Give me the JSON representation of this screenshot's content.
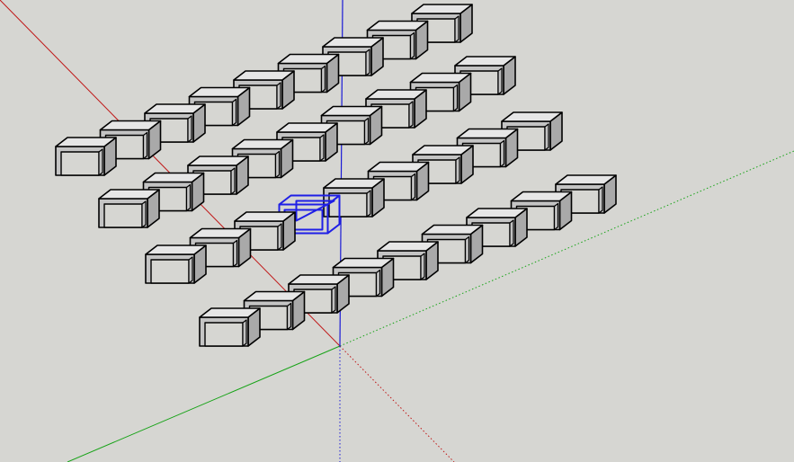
{
  "viewport": {
    "background": "#d6d6d2",
    "axes": {
      "red": "#c01818",
      "green": "#17a317",
      "blue": "#1a1ad6"
    },
    "selection_color": "#1f1fe6",
    "component": "stool",
    "rows": 4,
    "seats_per_row": [
      9,
      9,
      9,
      9
    ],
    "selected_seat": {
      "row": 3,
      "index": 4
    }
  }
}
